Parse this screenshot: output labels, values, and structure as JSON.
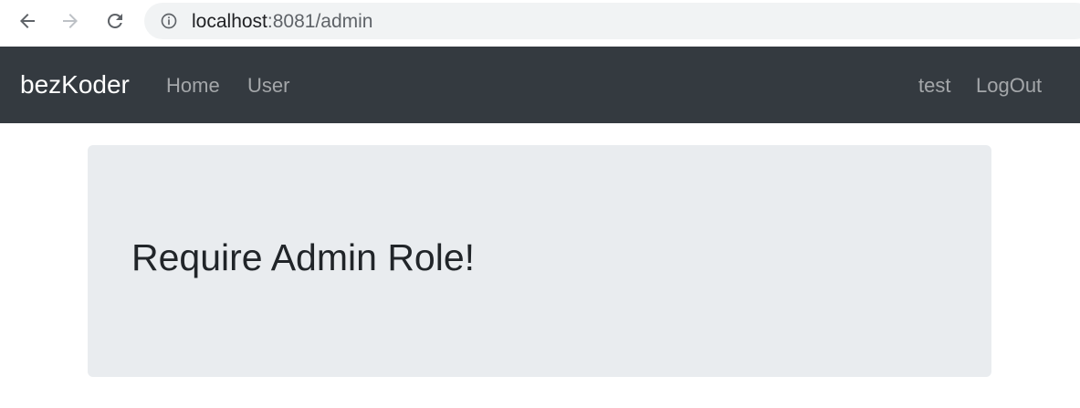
{
  "browser": {
    "url_host": "localhost",
    "url_path": ":8081/admin",
    "icons": {
      "back": "arrow-left-icon",
      "forward": "arrow-right-icon",
      "reload": "reload-icon",
      "site_info": "info-icon"
    }
  },
  "navbar": {
    "brand": "bezKoder",
    "links": {
      "home": "Home",
      "user": "User",
      "username": "test",
      "logout": "LogOut"
    },
    "colors": {
      "background": "#343a40",
      "brand_text": "#ffffff",
      "link_text": "rgba(255,255,255,0.55)"
    }
  },
  "main": {
    "title": "Require Admin Role!",
    "colors": {
      "jumbotron_bg": "#e9ecef",
      "title_text": "#212529"
    }
  }
}
